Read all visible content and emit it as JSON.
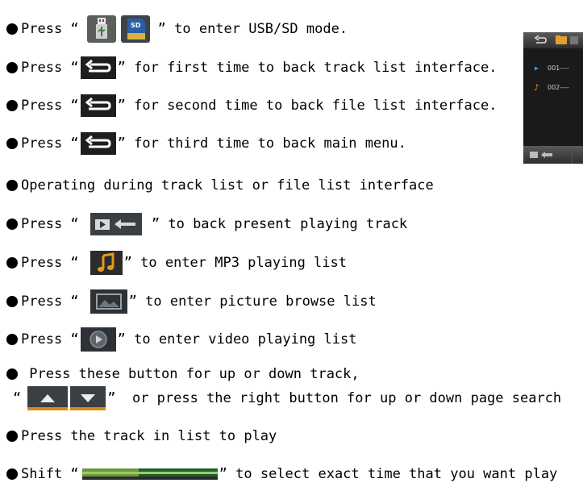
{
  "lines": [
    {
      "pre": "Press “",
      "post": "” to enter USB/SD mode."
    },
    {
      "pre": "Press “",
      "post": "” for first time to back track list interface."
    },
    {
      "pre": "Press “",
      "post": "” for second time to back file list interface."
    },
    {
      "pre": "Press “",
      "post": "” for third time to back main menu."
    },
    {
      "pre": "Operating during track list or file list interface"
    },
    {
      "pre": "Press “",
      "post": " ” to back present playing track"
    },
    {
      "pre": "Press “",
      "post": "” to enter MP3 playing list"
    },
    {
      "pre": "Press “",
      "post": "” to enter picture browse list"
    },
    {
      "pre": "Press “",
      "post": "” to enter video playing list"
    },
    {
      "pre": " Press these button for up or down track,"
    },
    {
      "pre": "“",
      "post": "”  or press the right button for up or down page search"
    },
    {
      "pre": "Press the track in list to play"
    },
    {
      "pre": "Shift “",
      "post": "” to select exact time that you want play"
    }
  ],
  "device": {
    "track1": "001----",
    "track2": "002----"
  },
  "icons": {
    "usb": "usb-icon",
    "sd": "sd-card-icon",
    "back": "back-arrow-icon",
    "now_playing": "now-playing-icon",
    "music": "music-note-icon",
    "picture": "picture-icon",
    "video": "video-play-icon",
    "up": "up-arrow-icon",
    "down": "down-arrow-icon",
    "progress": "progress-bar-icon"
  },
  "colors": {
    "icon_dark": "#1e1e1e",
    "music_orange": "#d9880e",
    "device_blue": "#3aa0ff",
    "progress_green": "#2e8b3a"
  }
}
